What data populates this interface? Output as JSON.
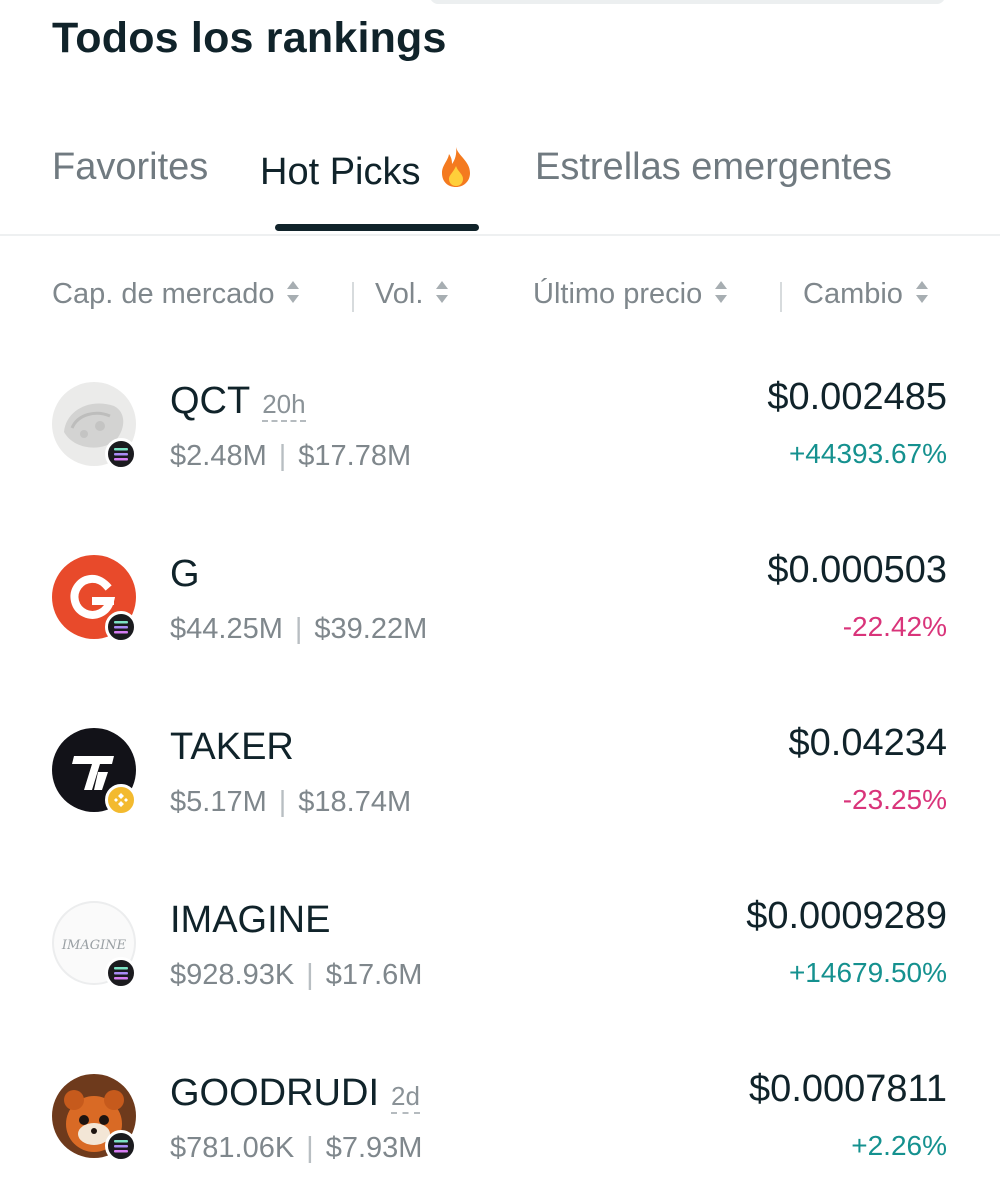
{
  "page": {
    "title": "Todos los rankings"
  },
  "tabs": [
    {
      "label": "Favorites",
      "active": false
    },
    {
      "label": "Hot Picks",
      "active": true,
      "icon": "flame-icon"
    },
    {
      "label": "Estrellas emergentes",
      "active": false
    }
  ],
  "sort_columns": [
    {
      "label": "Cap. de mercado",
      "icon": "sort-icon"
    },
    {
      "label": "Vol.",
      "icon": "sort-icon"
    },
    {
      "label": "Último precio",
      "icon": "sort-icon"
    },
    {
      "label": "Cambio",
      "icon": "sort-icon"
    }
  ],
  "tokens": [
    {
      "symbol": "QCT",
      "age": "20h",
      "market_cap": "$2.48M",
      "volume": "$17.78M",
      "price": "$0.002485",
      "change": "+44393.67%",
      "trend": "up",
      "chain": "solana"
    },
    {
      "symbol": "G",
      "age": "",
      "market_cap": "$44.25M",
      "volume": "$39.22M",
      "price": "$0.000503",
      "change": "-22.42%",
      "trend": "down",
      "chain": "solana"
    },
    {
      "symbol": "TAKER",
      "age": "",
      "market_cap": "$5.17M",
      "volume": "$18.74M",
      "price": "$0.04234",
      "change": "-23.25%",
      "trend": "down",
      "chain": "bnb"
    },
    {
      "symbol": "IMAGINE",
      "age": "",
      "market_cap": "$928.93K",
      "volume": "$17.6M",
      "price": "$0.0009289",
      "change": "+14679.50%",
      "trend": "up",
      "chain": "solana",
      "logo_text": "IMAGINE"
    },
    {
      "symbol": "GOODRUDI",
      "age": "2d",
      "market_cap": "$781.06K",
      "volume": "$7.93M",
      "price": "$0.0007811",
      "change": "+2.26%",
      "trend": "up",
      "chain": "solana"
    }
  ],
  "colors": {
    "up": "#15918f",
    "down": "#d9347a",
    "text": "#10232a",
    "muted": "#7f878c"
  }
}
